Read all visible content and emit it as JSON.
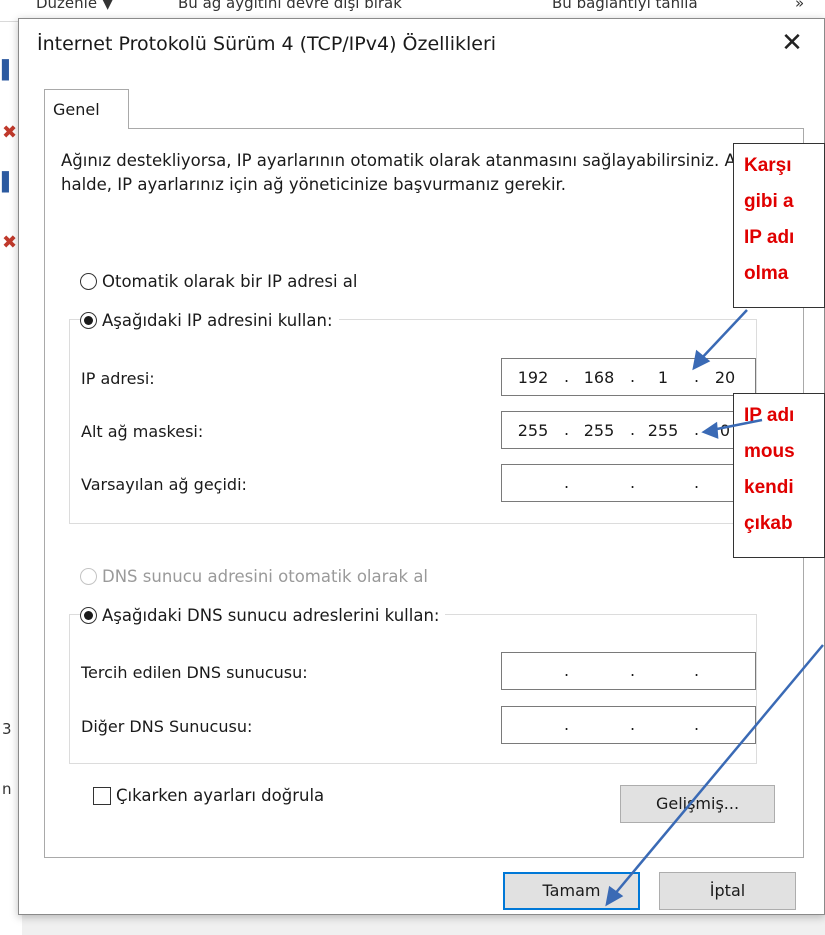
{
  "background": {
    "toolbar_items": [
      "Düzenle ▼",
      "Bu ağ aygıtını devre dışı bırak",
      "Bu bağlantıyı tanıla",
      "»"
    ],
    "left_fragments": [
      "3",
      "n"
    ]
  },
  "dialog": {
    "title": "İnternet Protokolü Sürüm 4 (TCP/IPv4) Özellikleri",
    "close_symbol": "✕",
    "tab": "Genel",
    "description": "Ağınız destekliyorsa, IP ayarlarının otomatik olarak atanmasını sağlayabilirsiniz. Aksi halde, IP ayarlarınız için ağ yöneticinize başvurmanız gerekir.",
    "ip": {
      "auto_label": "Otomatik olarak bir IP adresi al",
      "manual_label": "Aşağıdaki IP adresini kullan:",
      "selected": "manual",
      "fields": [
        {
          "label": "IP adresi:",
          "octets": [
            "192",
            "168",
            "1",
            "20"
          ]
        },
        {
          "label": "Alt ağ maskesi:",
          "octets": [
            "255",
            "255",
            "255",
            "0"
          ]
        },
        {
          "label": "Varsayılan ağ geçidi:",
          "octets": [
            "",
            "",
            "",
            ""
          ]
        }
      ]
    },
    "dns": {
      "auto_label": "DNS sunucu adresini otomatik olarak al",
      "manual_label": "Aşağıdaki DNS sunucu adreslerini kullan:",
      "selected": "manual",
      "fields": [
        {
          "label": "Tercih edilen DNS sunucusu:",
          "octets": [
            "",
            "",
            "",
            ""
          ]
        },
        {
          "label": "Diğer DNS Sunucusu:",
          "octets": [
            "",
            "",
            "",
            ""
          ]
        }
      ]
    },
    "validate_label": "Çıkarken ayarları doğrula",
    "validate_checked": false,
    "advanced_button": "Gelişmiş...",
    "ok_button": "Tamam",
    "cancel_button": "İptal"
  },
  "annotations": {
    "callout_1": [
      "Karşı",
      "gibi a",
      "IP adı",
      "olma"
    ],
    "callout_2": [
      "IP adı",
      "mous",
      "kendi",
      "çıkab"
    ],
    "text_color": "#e00000",
    "arrow_color": "#3a6ab5"
  }
}
